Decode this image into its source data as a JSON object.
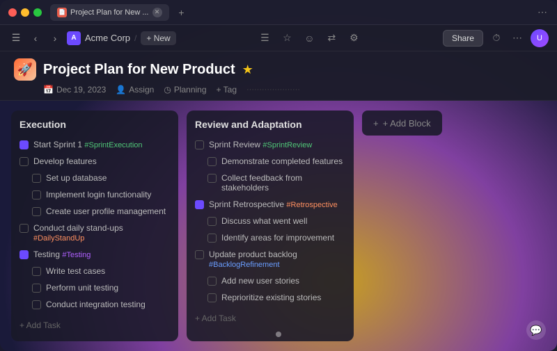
{
  "window": {
    "title": "Project Plan for New ...",
    "tab_label": "Project Plan for New ...",
    "traffic_lights": [
      "red",
      "yellow",
      "green"
    ]
  },
  "toolbar": {
    "workspace": "Acme Corp",
    "new_label": "+ New",
    "share_label": "Share",
    "center_icons": [
      "inbox",
      "star",
      "emoji",
      "share2",
      "users"
    ]
  },
  "page": {
    "title": "Project Plan for New Product",
    "icon": "🚀",
    "star": "★",
    "meta": {
      "date_icon": "📅",
      "date": "Dec 19, 2023",
      "assign_label": "Assign",
      "planning_label": "Planning",
      "tag_label": "+ Tag"
    }
  },
  "columns": [
    {
      "id": "execution",
      "title": "Execution",
      "tasks": [
        {
          "id": 1,
          "text": "Start Sprint 1 ",
          "tag": "#SprintExecution",
          "tag_class": "green",
          "checked": true,
          "indent": 0
        },
        {
          "id": 2,
          "text": "Develop features",
          "tag": "",
          "tag_class": "",
          "checked": false,
          "indent": 0
        },
        {
          "id": 3,
          "text": "Set up database",
          "tag": "",
          "tag_class": "",
          "checked": false,
          "indent": 1
        },
        {
          "id": 4,
          "text": "Implement login functionality",
          "tag": "",
          "tag_class": "",
          "checked": false,
          "indent": 1
        },
        {
          "id": 5,
          "text": "Create user profile management",
          "tag": "",
          "tag_class": "",
          "checked": false,
          "indent": 1
        },
        {
          "id": 6,
          "text": "Conduct daily stand-ups ",
          "tag": "#DailyStandUp",
          "tag_class": "orange",
          "checked": false,
          "indent": 0
        },
        {
          "id": 7,
          "text": "Testing ",
          "tag": "#Testing",
          "tag_class": "purple",
          "checked": true,
          "indent": 0
        },
        {
          "id": 8,
          "text": "Write test cases",
          "tag": "",
          "tag_class": "",
          "checked": false,
          "indent": 1
        },
        {
          "id": 9,
          "text": "Perform unit testing",
          "tag": "",
          "tag_class": "",
          "checked": false,
          "indent": 1
        },
        {
          "id": 10,
          "text": "Conduct integration testing",
          "tag": "",
          "tag_class": "",
          "checked": false,
          "indent": 1
        }
      ],
      "add_task_label": "+ Add Task"
    },
    {
      "id": "review",
      "title": "Review and Adaptation",
      "tasks": [
        {
          "id": 1,
          "text": "Sprint Review ",
          "tag": "#SprintReview",
          "tag_class": "green",
          "checked": false,
          "indent": 0
        },
        {
          "id": 2,
          "text": "Demonstrate completed features",
          "tag": "",
          "tag_class": "",
          "checked": false,
          "indent": 1
        },
        {
          "id": 3,
          "text": "Collect feedback from stakeholders",
          "tag": "",
          "tag_class": "",
          "checked": false,
          "indent": 1
        },
        {
          "id": 4,
          "text": "Sprint Retrospective ",
          "tag": "#Retrospective",
          "tag_class": "orange",
          "checked": true,
          "indent": 0
        },
        {
          "id": 5,
          "text": "Discuss what went well",
          "tag": "",
          "tag_class": "",
          "checked": false,
          "indent": 1
        },
        {
          "id": 6,
          "text": "Identify areas for improvement",
          "tag": "",
          "tag_class": "",
          "checked": false,
          "indent": 1
        },
        {
          "id": 7,
          "text": "Update product backlog ",
          "tag": "#BacklogRefinement",
          "tag_class": "blue",
          "checked": false,
          "indent": 0
        },
        {
          "id": 8,
          "text": "Add new user stories",
          "tag": "",
          "tag_class": "",
          "checked": false,
          "indent": 1
        },
        {
          "id": 9,
          "text": "Reprioritize existing stories",
          "tag": "",
          "tag_class": "",
          "checked": false,
          "indent": 1
        }
      ],
      "add_task_label": "+ Add Task"
    }
  ],
  "add_block_label": "+ Add Block",
  "bottom_dot": true,
  "chat_icon": "💬"
}
